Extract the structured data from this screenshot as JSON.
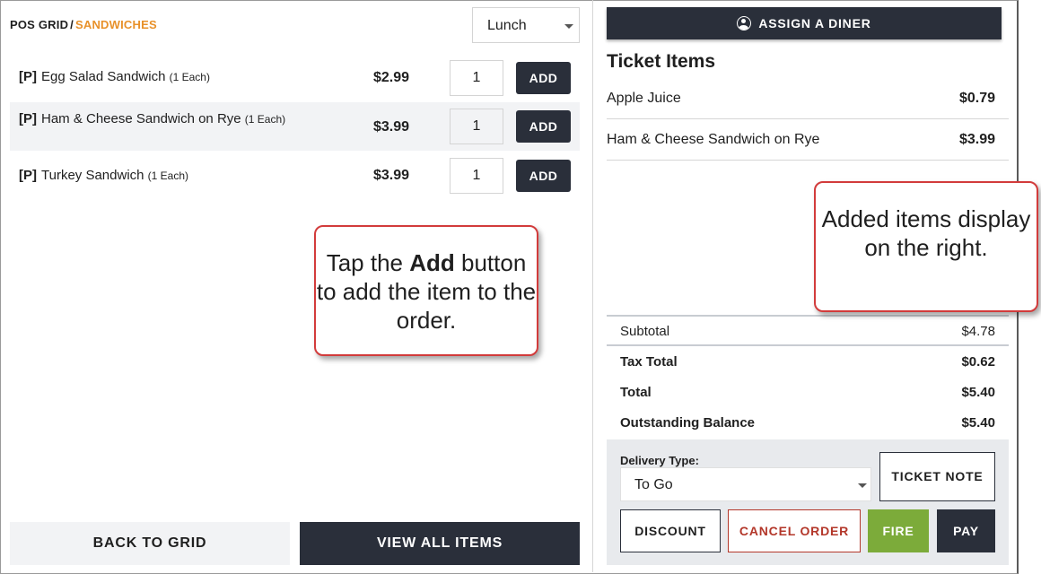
{
  "breadcrumb": {
    "root": "POS GRID",
    "separator": "/",
    "current": "SANDWICHES"
  },
  "meal_period": {
    "selected": "Lunch"
  },
  "menu_items": [
    {
      "tag": "[P]",
      "name": "Egg Salad Sandwich",
      "unit": "(1 Each)",
      "price": "$2.99",
      "qty": "1",
      "add_label": "ADD"
    },
    {
      "tag": "[P]",
      "name": "Ham & Cheese Sandwich on Rye",
      "unit": "(1 Each)",
      "price": "$3.99",
      "qty": "1",
      "add_label": "ADD"
    },
    {
      "tag": "[P]",
      "name": "Turkey Sandwich",
      "unit": "(1 Each)",
      "price": "$3.99",
      "qty": "1",
      "add_label": "ADD"
    }
  ],
  "callouts": {
    "left": {
      "pre": "Tap the ",
      "bold": "Add",
      "post": " button to add the item to the order."
    },
    "right": {
      "text": "Added items display on the right."
    }
  },
  "footer": {
    "back_label": "BACK TO GRID",
    "view_all_label": "VIEW ALL ITEMS"
  },
  "ticket": {
    "assign_label": "ASSIGN A DINER",
    "title": "Ticket Items",
    "items": [
      {
        "name": "Apple Juice",
        "price": "$0.79"
      },
      {
        "name": "Ham & Cheese Sandwich on Rye",
        "price": "$3.99"
      }
    ],
    "subtotal": {
      "label": "Subtotal",
      "value": "$4.78"
    },
    "tax_total": {
      "label": "Tax Total",
      "value": "$0.62"
    },
    "total": {
      "label": "Total",
      "value": "$5.40"
    },
    "outstanding": {
      "label": "Outstanding Balance",
      "value": "$5.40"
    }
  },
  "actions": {
    "delivery_label": "Delivery Type:",
    "delivery_value": "To Go",
    "ticket_note_label": "TICKET NOTE",
    "discount_label": "DISCOUNT",
    "cancel_label": "CANCEL ORDER",
    "fire_label": "FIRE",
    "pay_label": "PAY"
  },
  "colors": {
    "accent_orange": "#e8912a",
    "dark_button": "#2a2f3a",
    "fire_green": "#7cab3a",
    "cancel_red": "#b3372a",
    "callout_border": "#d23b3b"
  }
}
